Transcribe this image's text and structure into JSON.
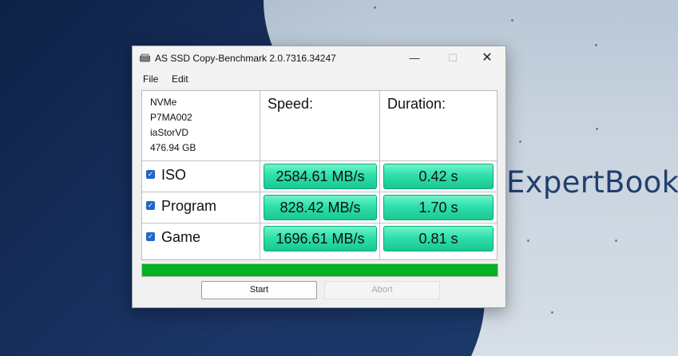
{
  "window": {
    "title": "AS SSD Copy-Benchmark 2.0.7316.34247",
    "controls": {
      "minimize": "—",
      "maximize": "☐",
      "close": "✕"
    }
  },
  "menu": {
    "file": "File",
    "edit": "Edit"
  },
  "drive": {
    "model": "NVMe",
    "firmware": "P7MA002",
    "driver": "iaStorVD",
    "size": "476.94 GB"
  },
  "headers": {
    "speed": "Speed:",
    "duration": "Duration:"
  },
  "rows": [
    {
      "label": "ISO",
      "checked": true,
      "speed": "2584.61 MB/s",
      "duration": "0.42 s"
    },
    {
      "label": "Program",
      "checked": true,
      "speed": "828.42 MB/s",
      "duration": "1.70 s"
    },
    {
      "label": "Game",
      "checked": true,
      "speed": "1696.61 MB/s",
      "duration": "0.81 s"
    }
  ],
  "progress": {
    "value_percent": 100,
    "color": "#06b025"
  },
  "buttons": {
    "start": "Start",
    "abort": "Abort"
  },
  "wallpaper": {
    "brand_text": "ExpertBook"
  },
  "colors": {
    "result_fill": "#2fdfab",
    "checkbox": "#1f66c9"
  }
}
